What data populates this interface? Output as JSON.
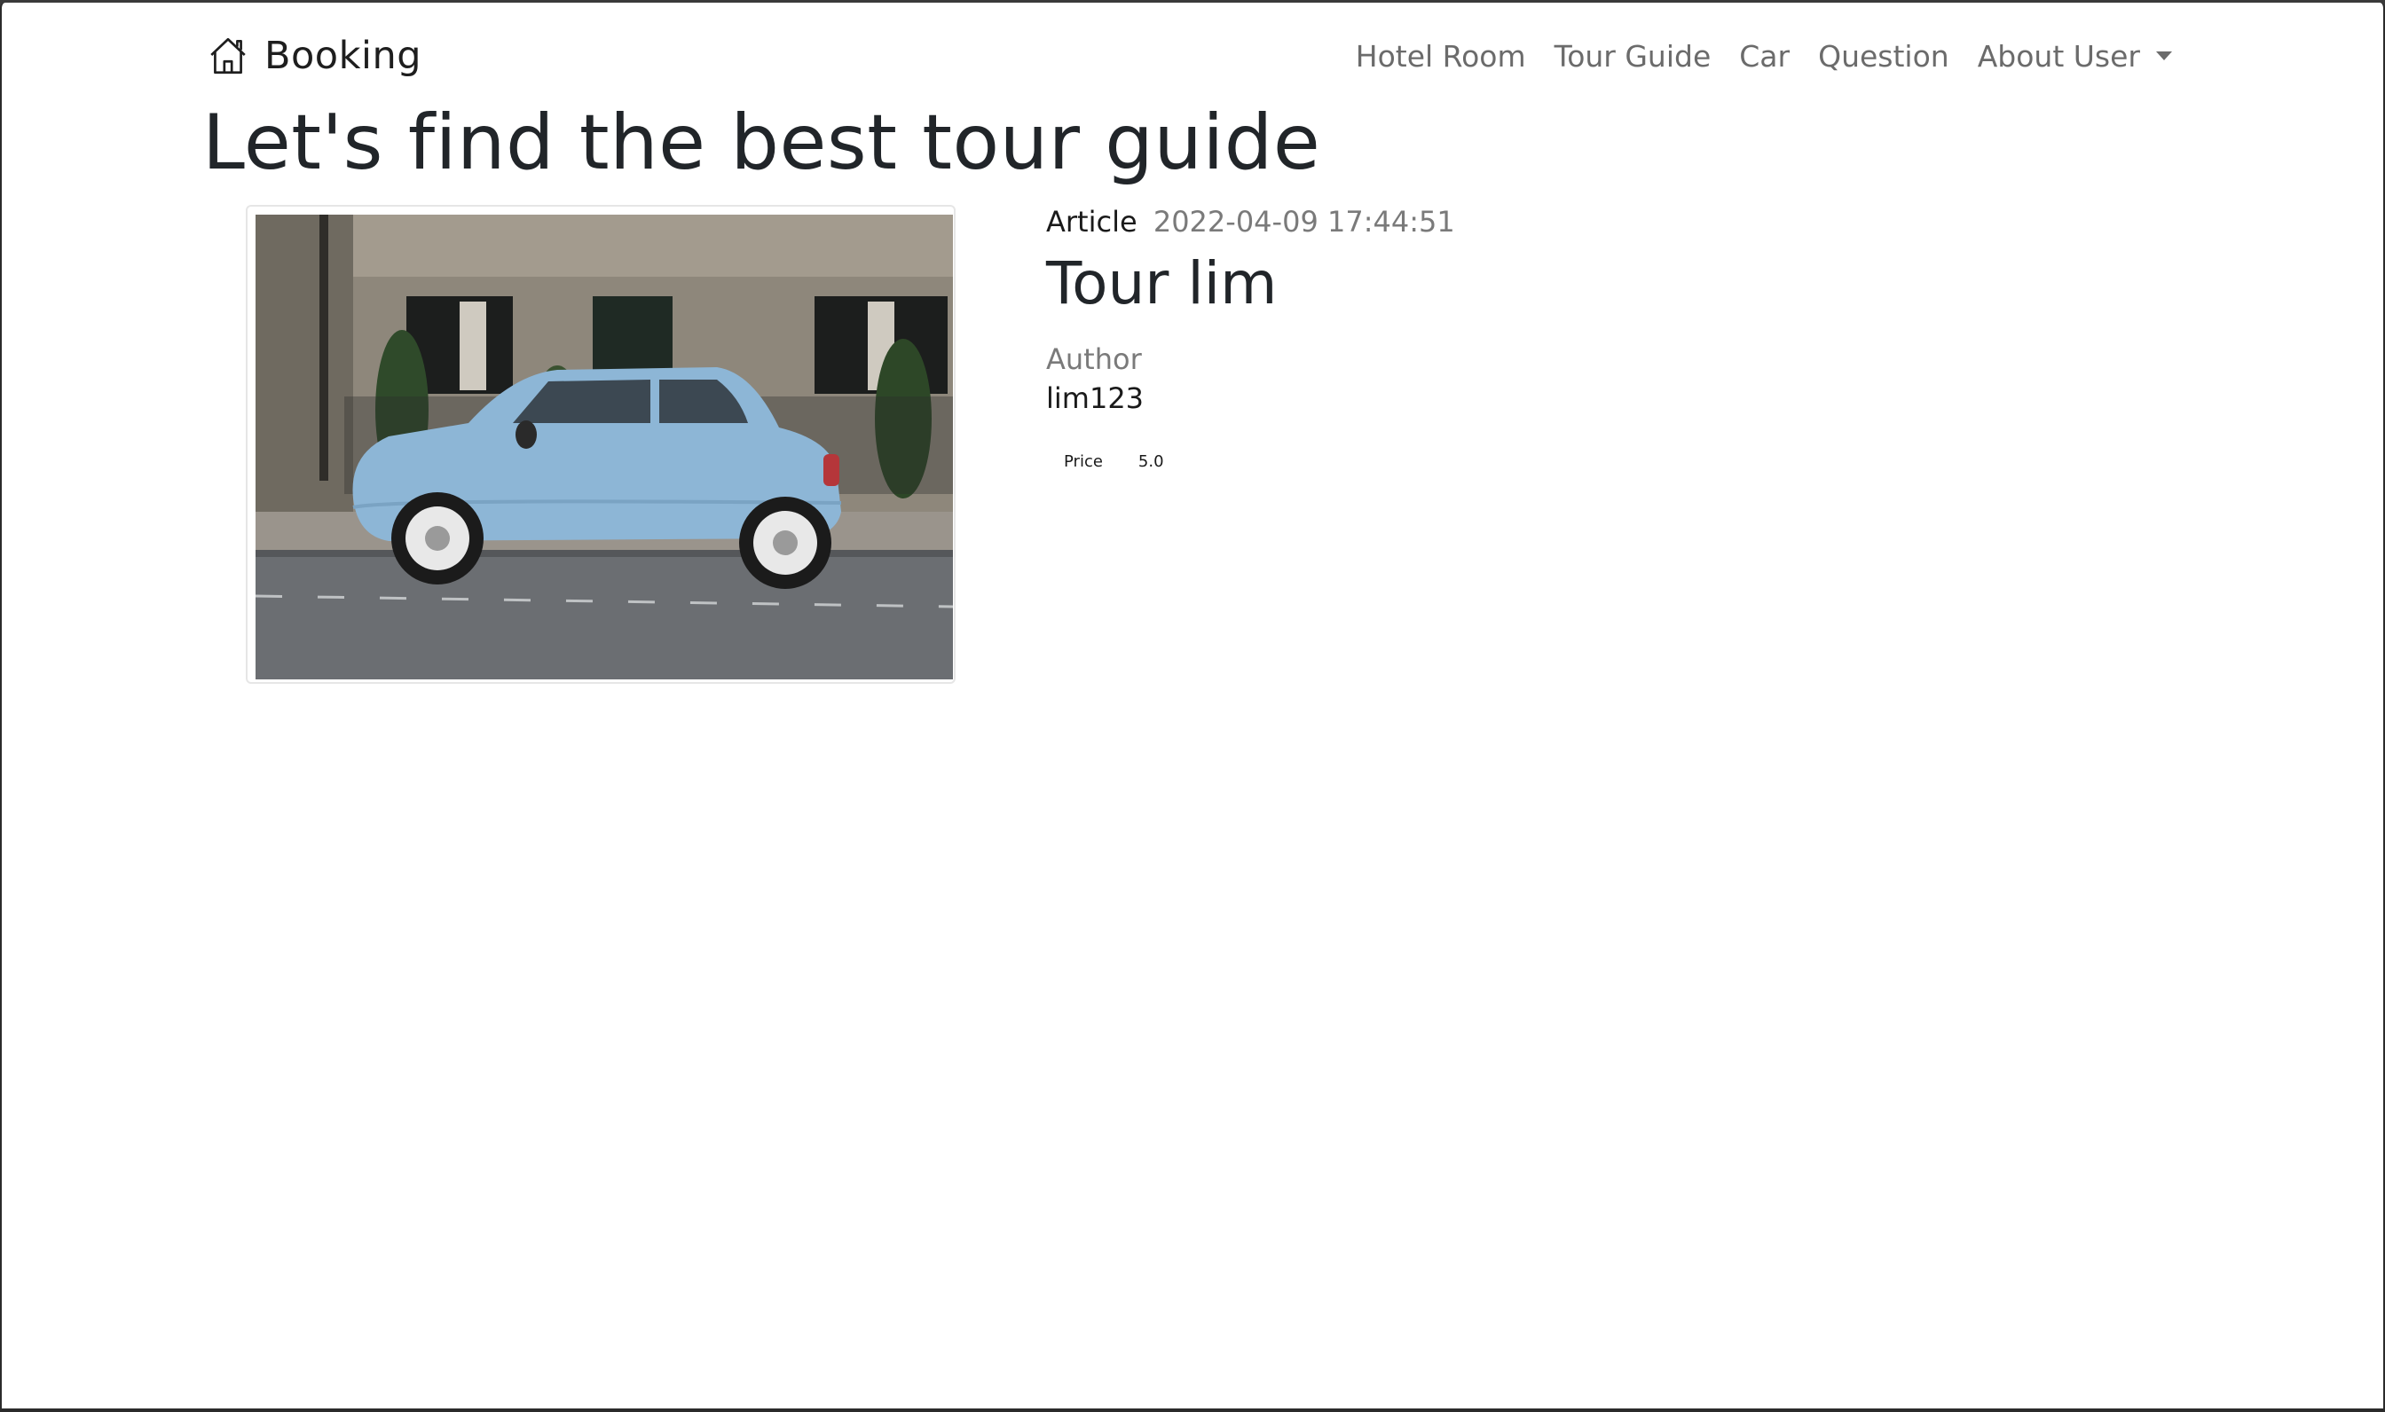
{
  "navbar": {
    "brand": "Booking",
    "links": [
      "Hotel Room",
      "Tour Guide",
      "Car",
      "Question"
    ],
    "user_menu": "About User"
  },
  "page": {
    "heading": "Let's find the best tour guide"
  },
  "article": {
    "label": "Article",
    "date": "2022-04-09 17:44:51",
    "title": "Tour lim",
    "author_label": "Author",
    "author": "lim123",
    "price_label": "Price",
    "price_value": "5.0"
  }
}
